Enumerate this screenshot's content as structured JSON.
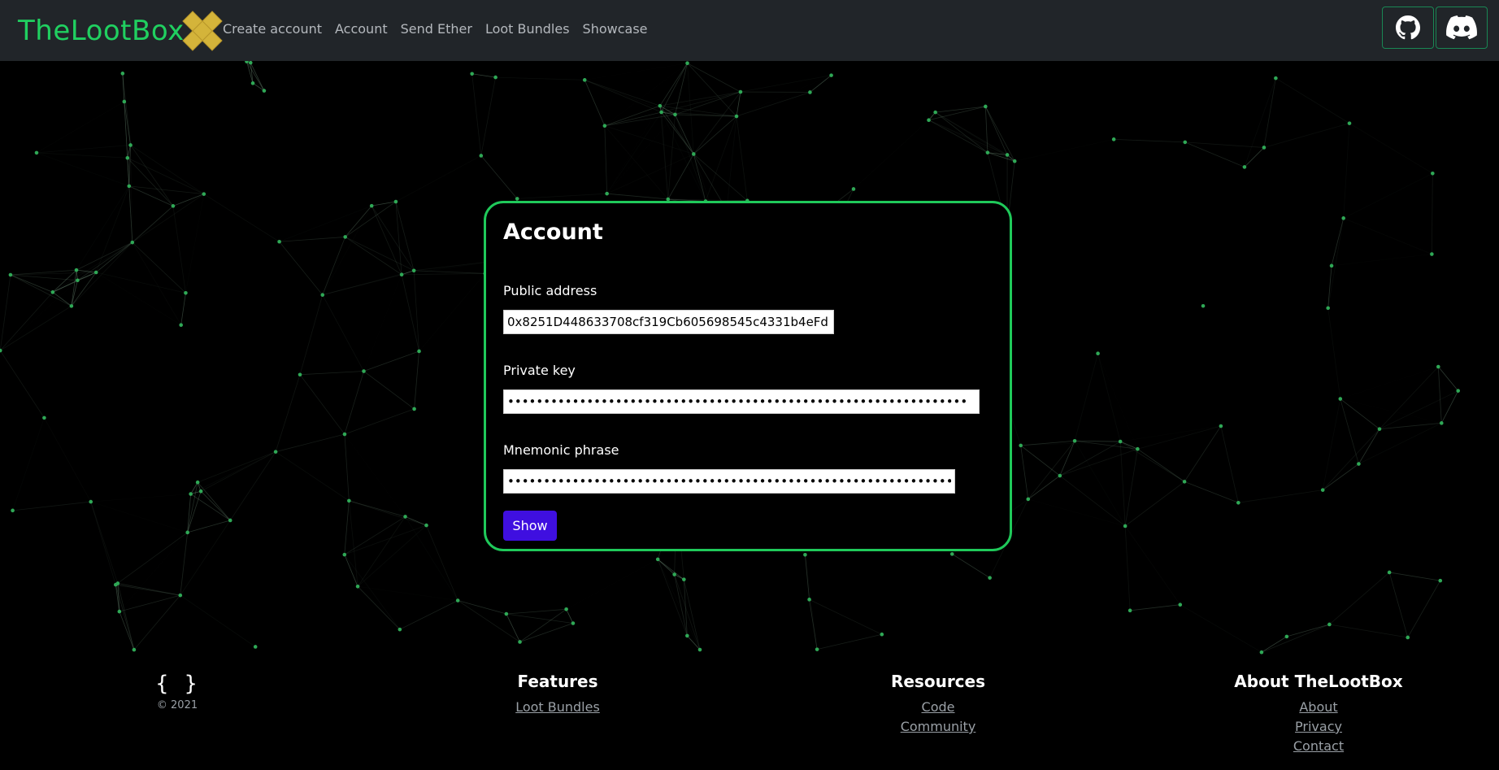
{
  "brand": {
    "name": "TheLootBox",
    "accent": "#20d060",
    "logo_color": "#d4b43a"
  },
  "nav": {
    "links": [
      "Create account",
      "Account",
      "Send Ether",
      "Loot Bundles",
      "Showcase"
    ]
  },
  "social": {
    "github_icon": "github-icon",
    "discord_icon": "discord-icon"
  },
  "card": {
    "title": "Account",
    "public_address_label": "Public address",
    "public_address_value": "0x8251D448633708cf319Cb605698545c4331b4eFd",
    "private_key_label": "Private key",
    "private_key_value": "••••••••••••••••••••••••••••••••••••••••••••••••••••••••••••••••",
    "mnemonic_label": "Mnemonic phrase",
    "mnemonic_value": "•••••••••••••••••••••••••••••••••••••••••••••••••••••••••••••••••••••",
    "show_button": "Show",
    "border_color": "#1fc95a",
    "button_color": "#3f0fe0"
  },
  "footer": {
    "braces": "{ }",
    "copyright": "© 2021",
    "features": {
      "heading": "Features",
      "links": [
        "Loot Bundles"
      ]
    },
    "resources": {
      "heading": "Resources",
      "links": [
        "Code",
        "Community"
      ]
    },
    "about": {
      "heading": "About TheLootBox",
      "links": [
        "About",
        "Privacy",
        "Contact"
      ]
    }
  }
}
